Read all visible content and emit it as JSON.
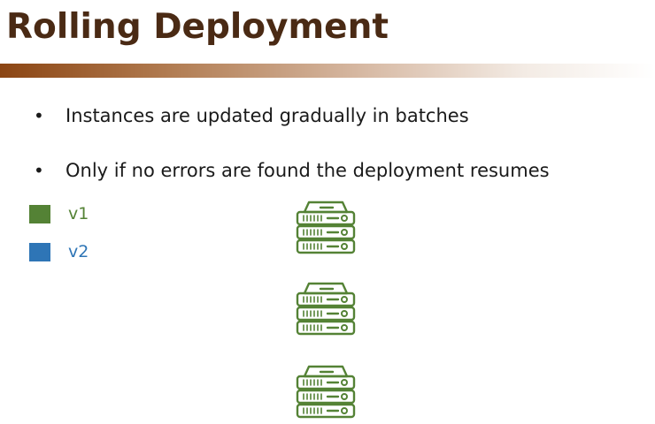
{
  "slide": {
    "title": "Rolling Deployment",
    "bullets": [
      "Instances are updated gradually in batches",
      "Only if no errors are found the deployment resumes"
    ],
    "bullet_marker": "•"
  },
  "legend": {
    "items": [
      {
        "label": "v1",
        "color": "#548235"
      },
      {
        "label": "v2",
        "color": "#2e75b6"
      }
    ]
  },
  "servers": {
    "icon": "server-rack-icon",
    "count": 3,
    "version_of_each": [
      "v1",
      "v1",
      "v1"
    ],
    "stroke_color": "#548235"
  }
}
